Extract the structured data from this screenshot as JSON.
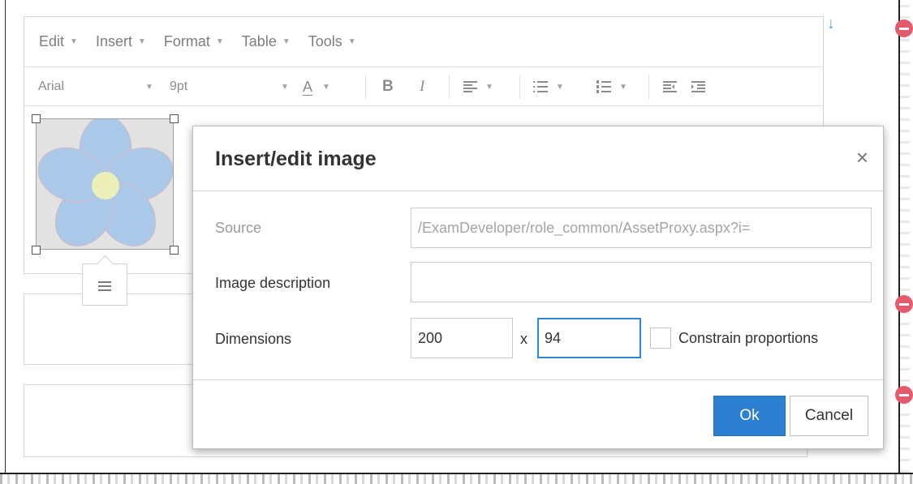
{
  "menubar": {
    "items": [
      {
        "label": "Edit"
      },
      {
        "label": "Insert"
      },
      {
        "label": "Format"
      },
      {
        "label": "Table"
      },
      {
        "label": "Tools"
      }
    ]
  },
  "toolbar": {
    "font_family": "Arial",
    "font_size": "9pt",
    "text_color_glyph": "A",
    "bold_glyph": "B",
    "italic_glyph": "I"
  },
  "dialog": {
    "title": "Insert/edit image",
    "close_glyph": "×",
    "source_label": "Source",
    "source_value": "/ExamDeveloper/role_common/AssetProxy.aspx?i=",
    "description_label": "Image description",
    "description_value": "",
    "dimensions_label": "Dimensions",
    "width_value": "200",
    "dimension_separator": "x",
    "height_value": "94",
    "constrain_label": "Constrain proportions",
    "constrain_checked": false,
    "ok_label": "Ok",
    "cancel_label": "Cancel"
  },
  "colors": {
    "primary_button": "#2d7fd2",
    "focus_border": "#2d86d6",
    "indicator_red": "#e35a6b",
    "flower_petal": "#aac8e8",
    "flower_center": "#ecefb8"
  },
  "icons": {
    "dropdown": "caret-down-icon",
    "align_left": "align-left-icon",
    "bullet_list": "bullet-list-icon",
    "numbered_list": "numbered-list-icon",
    "outdent": "outdent-icon",
    "indent": "indent-icon",
    "image_align": "image-align-icon",
    "scroll_down": "arrow-down-icon",
    "remove": "minus-circle-icon"
  }
}
